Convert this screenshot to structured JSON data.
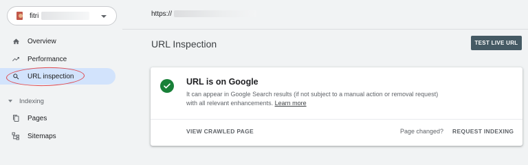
{
  "property": {
    "name": "fitri"
  },
  "url": {
    "prefix": "https://"
  },
  "sidebar": {
    "items": [
      {
        "label": "Overview",
        "icon": "home-icon"
      },
      {
        "label": "Performance",
        "icon": "trending-up-icon"
      },
      {
        "label": "URL inspection",
        "icon": "search-icon",
        "active": true
      }
    ],
    "indexing_section": {
      "label": "Indexing"
    },
    "indexing_items": [
      {
        "label": "Pages",
        "icon": "pages-icon"
      },
      {
        "label": "Sitemaps",
        "icon": "sitemap-icon"
      }
    ]
  },
  "main": {
    "title": "URL Inspection",
    "test_live_label": "TEST LIVE URL",
    "result": {
      "title": "URL is on Google",
      "description": "It can appear in Google Search results (if not subject to a manual action or removal request) with all relevant enhancements. ",
      "learn_more": "Learn more",
      "view_crawled_label": "VIEW CRAWLED PAGE",
      "page_changed_label": "Page changed?",
      "request_indexing_label": "REQUEST INDEXING"
    }
  },
  "colors": {
    "active_nav_bg": "#d2e3fc",
    "success_green": "#188038",
    "button_dark": "#455a64",
    "annotation_red": "#e0464a"
  }
}
